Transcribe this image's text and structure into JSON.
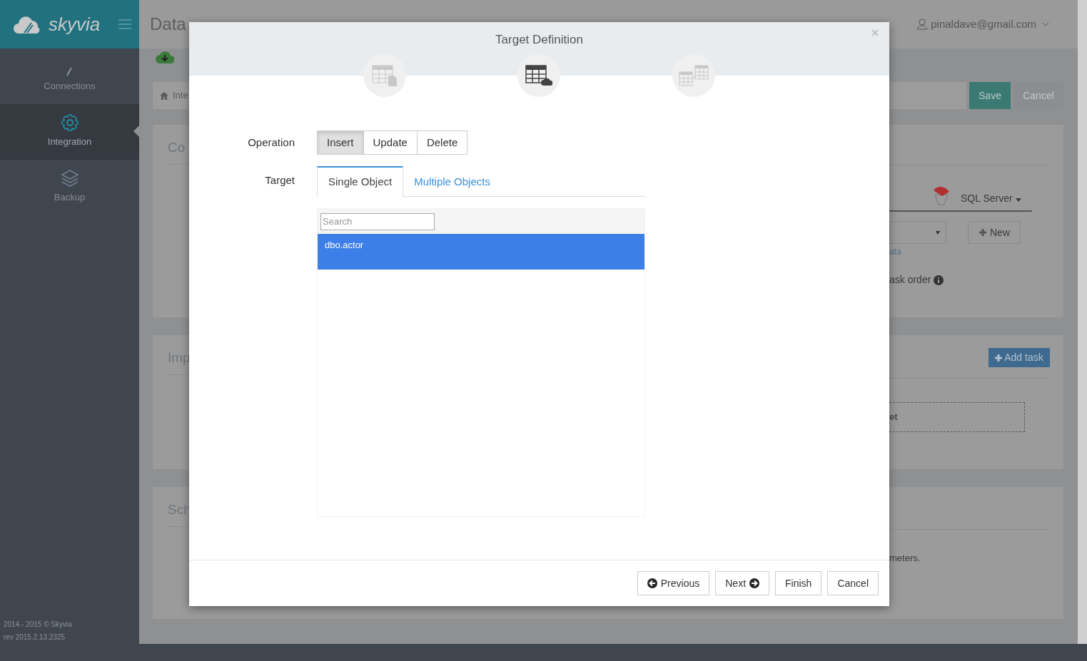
{
  "app": {
    "logo": "skyvia"
  },
  "sidebar": {
    "items": [
      {
        "label": "Connections",
        "kind": "connections",
        "selected": false
      },
      {
        "label": "Integration",
        "kind": "integration",
        "selected": true
      },
      {
        "label": "Backup",
        "kind": "backup",
        "selected": false
      }
    ],
    "footer": [
      "2014 - 2015 © Skyvia",
      "rev 2015.2.13.2325"
    ]
  },
  "header": {
    "title": "Data",
    "user": "pinaldave@gmail.com"
  },
  "page": {
    "breadcrumb": "Inte",
    "buttons": [
      {
        "label": "Save",
        "kind": "primary"
      },
      {
        "label": "Cancel",
        "kind": "secondary"
      }
    ],
    "panels": [
      {
        "heading": "Co",
        "connector": "SQL Server",
        "new_button": "New",
        "hint": "ata",
        "option": "ask order"
      },
      {
        "heading": "Imp",
        "add_button": "Add task",
        "dropzone": "et"
      },
      {
        "heading": "Sch",
        "note": "meters."
      }
    ]
  },
  "modal": {
    "title": "Target Definition",
    "steps": [
      {
        "kind": "source",
        "selected": false
      },
      {
        "kind": "target",
        "selected": true
      },
      {
        "kind": "mapping",
        "selected": false
      }
    ],
    "operation_label": "Operation",
    "operations": [
      {
        "label": "Insert",
        "selected": true
      },
      {
        "label": "Update",
        "selected": false
      },
      {
        "label": "Delete",
        "selected": false
      }
    ],
    "target_label": "Target",
    "tabs": [
      {
        "label": "Single Object",
        "selected": true
      },
      {
        "label": "Multiple Objects",
        "selected": false
      }
    ],
    "search": {
      "placeholder": "Search"
    },
    "objects": [
      {
        "label": "dbo.actor",
        "selected": true
      }
    ],
    "buttons": [
      {
        "label": "Previous",
        "kind": "previous"
      },
      {
        "label": "Next",
        "kind": "next"
      },
      {
        "label": "Finish",
        "kind": "plain"
      },
      {
        "label": "Cancel",
        "kind": "plain"
      }
    ]
  }
}
